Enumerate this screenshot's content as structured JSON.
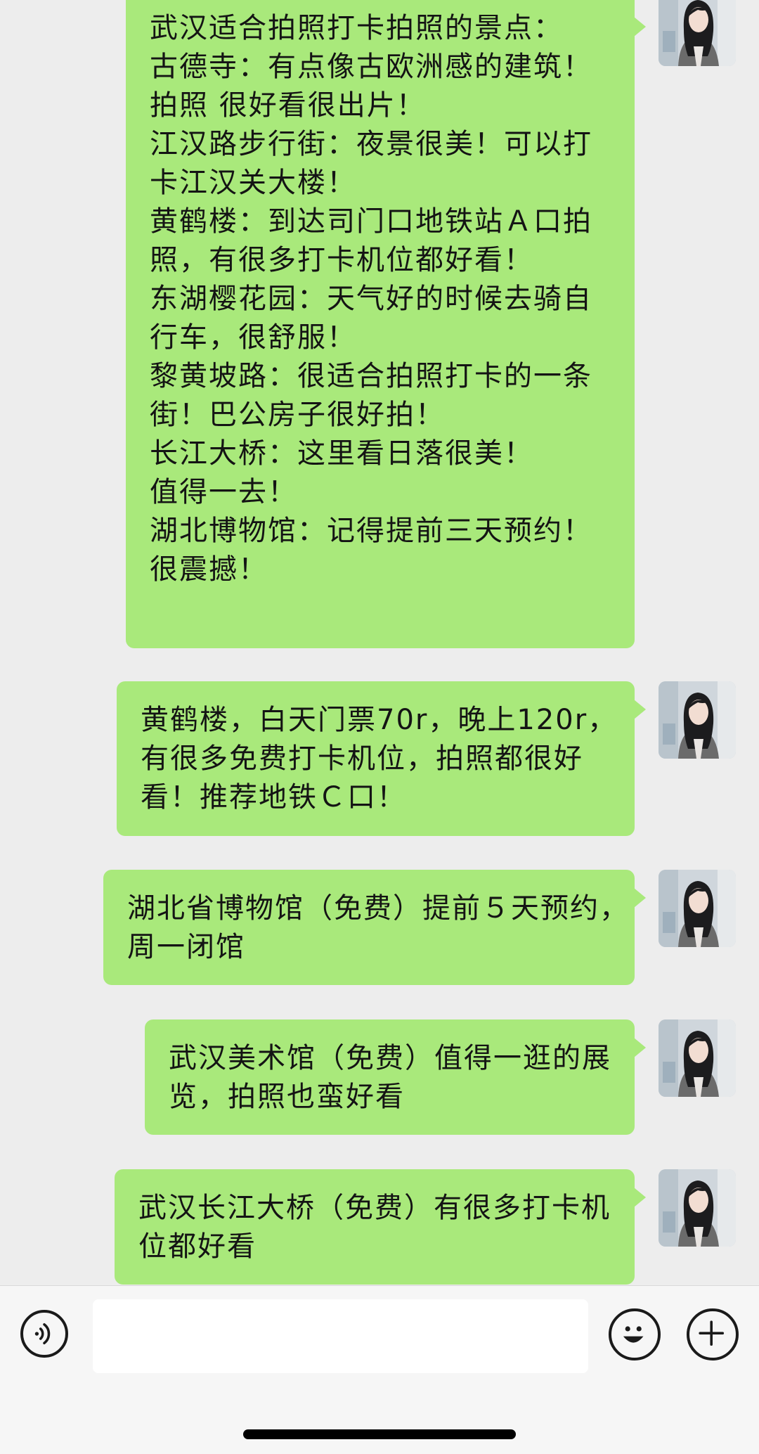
{
  "messages": [
    {
      "sender": "me",
      "lines": [
        "武汉适合拍照打卡拍照的景点：",
        "",
        "古德寺：有点像古欧洲感的建筑！",
        "拍照 很好看很出片！",
        "江汉路步行街：夜景很美！可以打",
        "卡江汉关大楼！",
        "黄鹤楼：到达司门口地铁站Ａ口拍",
        "照，有很多打卡机位都好看！",
        "东湖樱花园：天气好的时候去骑自",
        "行车，很舒服！",
        "黎黄坡路：很适合拍照打卡的一条",
        "街！巴公房子很好拍！",
        "长江大桥：这里看日落很美！",
        "值得一去！",
        "湖北博物馆：记得提前三天预约！",
        "很震撼！"
      ]
    },
    {
      "sender": "me",
      "lines": [
        "黄鹤楼，白天门票70r，晚上120r，",
        "有很多免费打卡机位，拍照都很好",
        "看！推荐地铁Ｃ口！"
      ]
    },
    {
      "sender": "me",
      "lines": [
        "湖北省博物馆（免费）提前５天预约，",
        "周一闭馆"
      ]
    },
    {
      "sender": "me",
      "lines": [
        "武汉美术馆（免费）值得一逛的展",
        "览，拍照也蛮好看"
      ]
    },
    {
      "sender": "me",
      "lines": [
        "武汉长江大桥（免费）有很多打卡机",
        "位都好看"
      ]
    }
  ],
  "input_bar": {
    "voice_icon": "voice-icon",
    "message_value": "",
    "emoji_icon": "emoji-icon",
    "plus_icon": "plus-icon"
  },
  "colors": {
    "bubble": "#a9e97b",
    "background": "#ededed"
  }
}
